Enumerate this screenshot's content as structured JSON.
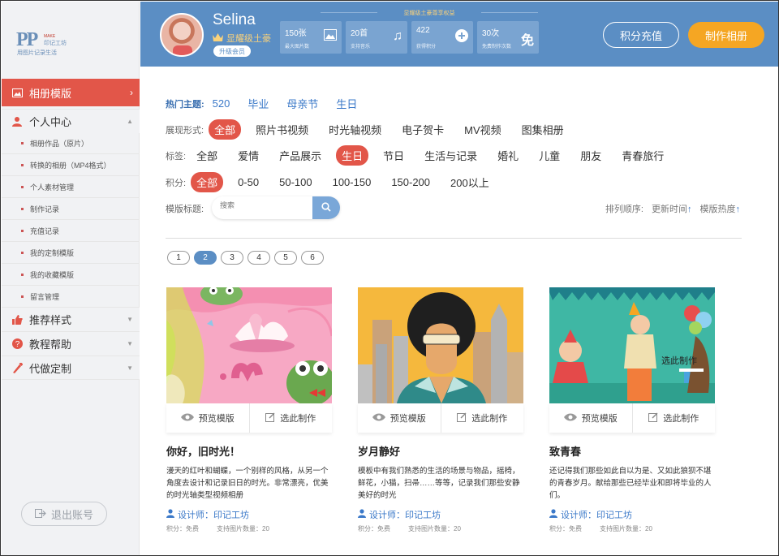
{
  "brand": {
    "logo_mark": "PP",
    "logo_make": "MAKE",
    "logo_cn": "印记工坊",
    "logo_sub": "用图片记录生活"
  },
  "sidebar": {
    "sections": [
      {
        "label": "相册模版",
        "icon": "image-icon",
        "active": true
      },
      {
        "label": "个人中心",
        "icon": "user-icon",
        "active": false
      },
      {
        "label": "推荐样式",
        "icon": "thumbs-up-icon",
        "active": false
      },
      {
        "label": "教程帮助",
        "icon": "help-icon",
        "active": false
      },
      {
        "label": "代做定制",
        "icon": "brush-icon",
        "active": false
      }
    ],
    "sub_items": [
      "相册作品（原片）",
      "转换的相册（MP4格式）",
      "个人素材管理",
      "制作记录",
      "充值记录",
      "我的定制模版",
      "我的收藏模版",
      "留言管理"
    ],
    "logout": "退出账号"
  },
  "header": {
    "username": "Selina",
    "level": "显耀级土豪",
    "upgrade": "升级会员",
    "perk_title": "显耀级土豪尊享权益",
    "perks": [
      {
        "value": "150张",
        "label": "最大图片数",
        "icon": "photo-icon"
      },
      {
        "value": "20首",
        "label": "支持音乐",
        "icon": "music-icon"
      },
      {
        "value": "422",
        "label": "获得积分",
        "icon": "plus-icon"
      },
      {
        "value": "30次",
        "label": "免费制作次数",
        "icon": "免"
      }
    ],
    "recharge": "积分充值",
    "make_album": "制作相册"
  },
  "filters": {
    "hot_label": "热门主题:",
    "hot": [
      "520",
      "毕业",
      "母亲节",
      "生日"
    ],
    "display_label": "展现形式:",
    "display": [
      "全部",
      "照片书视频",
      "时光轴视频",
      "电子贺卡",
      "MV视频",
      "图集相册"
    ],
    "display_selected": "全部",
    "tag_label": "标签:",
    "tags": [
      "全部",
      "爱情",
      "产品展示",
      "生日",
      "节日",
      "生活与记录",
      "婚礼",
      "儿童",
      "朋友",
      "青春旅行"
    ],
    "tag_selected": "生日",
    "points_label": "积分:",
    "points": [
      "全部",
      "0-50",
      "50-100",
      "100-150",
      "150-200",
      "200以上"
    ],
    "points_selected": "全部",
    "title_label": "模版标题:",
    "search_placeholder": "搜索",
    "sort_label": "排列顺序:",
    "sort_time": "更新时间",
    "sort_hot": "模版热度"
  },
  "pagination": {
    "pages": [
      "1",
      "2",
      "3",
      "4",
      "5",
      "6"
    ],
    "current": "2"
  },
  "cards": [
    {
      "title": "你好，旧时光！",
      "desc": "漫天的红叶和蝴蝶，一个别样的风格，从另一个角度去设计和记录旧日的时光。非常漂亮，优美的时光轴类型视频相册",
      "preview": "预览模版",
      "select": "选此制作",
      "designer": "设计师：印记工坊",
      "points": "积分：免费",
      "photos": "支持图片数量：20"
    },
    {
      "title": "岁月静好",
      "desc": "模板中有我们熟悉的生活的场景与物品，摇椅，鲜花，小猫，扫帚……等等，记录我们那些安静美好的时光",
      "preview": "预览模版",
      "select": "选此制作",
      "designer": "设计师：印记工坊",
      "points": "积分：免费",
      "photos": "支持图片数量：20"
    },
    {
      "title": "致青春",
      "desc": "还记得我们那些如此自以为是、又如此狼狈不堪的青春岁月。献给那些已经毕业和即将毕业的人们。",
      "preview": "预览模版",
      "select": "选此制作",
      "designer": "设计师：印记工坊",
      "points": "积分：免费",
      "photos": "支持图片数量：20",
      "hover_text": "选此制作"
    }
  ],
  "colors": {
    "accent_red": "#e25649",
    "header_blue": "#5b8ec4",
    "orange": "#f5a623",
    "link_blue": "#3a78c8"
  }
}
